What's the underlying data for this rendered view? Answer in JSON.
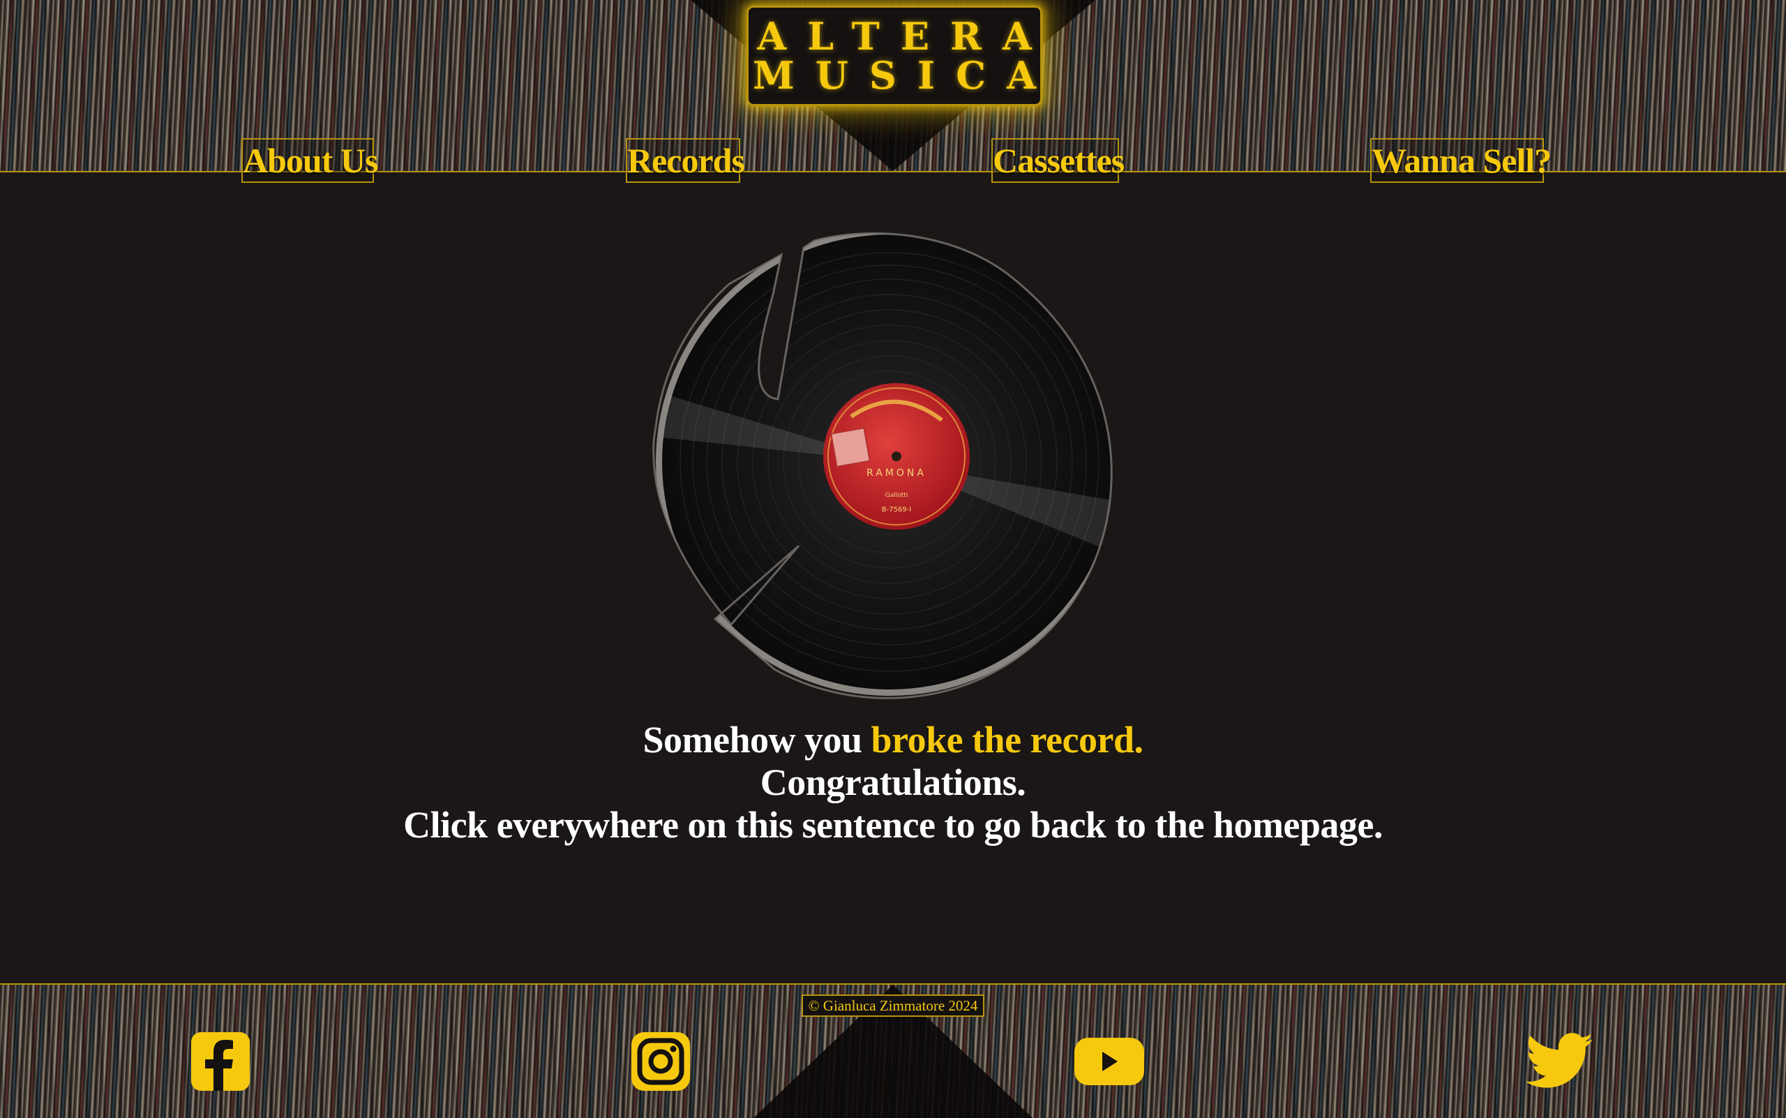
{
  "brand": {
    "line1": "ALTERA",
    "line2": "MUSICA"
  },
  "nav": {
    "items": [
      {
        "label": "About Us"
      },
      {
        "label": "Records"
      },
      {
        "label": "Cassettes"
      },
      {
        "label": "Wanna Sell?"
      }
    ]
  },
  "record_label": {
    "title": "RAMONA",
    "catalog": "B-7569-I",
    "artist": "Gallotti"
  },
  "message": {
    "line1_prefix": "Somehow you",
    "line1_highlight": "broke the record.",
    "line2": "Congratulations.",
    "line3": "Click everywhere on this sentence to go back to the homepage."
  },
  "footer": {
    "copyright": "© Gianluca Zimmatore 2024",
    "social": [
      "facebook-icon",
      "instagram-icon",
      "youtube-icon",
      "twitter-icon"
    ]
  },
  "colors": {
    "accent": "#f6c90e",
    "background": "#1b1716",
    "text": "#ffffff",
    "label_red": "#c8202a"
  }
}
